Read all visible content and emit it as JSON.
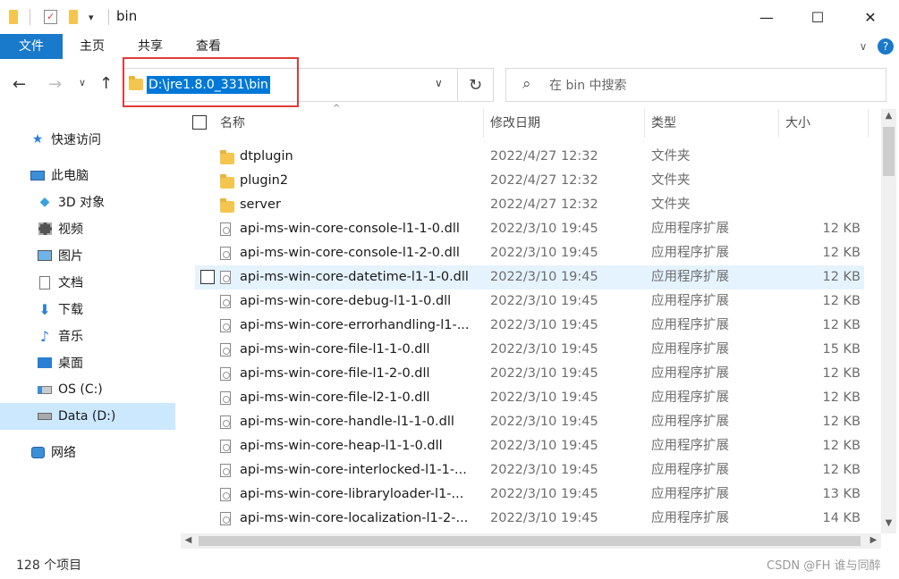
{
  "window": {
    "title": "bin",
    "minimize_glyph": "—",
    "maximize_glyph": "☐",
    "close_glyph": "✕"
  },
  "ribbon": {
    "tabs": [
      "文件",
      "主页",
      "共享",
      "查看"
    ],
    "collapse_glyph": "∨",
    "help_glyph": "?"
  },
  "address": {
    "path": "D:\\jre1.8.0_331\\bin",
    "dropdown_glyph": "∨",
    "refresh_glyph": "↻",
    "search_placeholder": "在 bin 中搜索"
  },
  "sidebar": {
    "items": [
      {
        "label": "快速访问",
        "icon": "star-icon"
      },
      {
        "label": "此电脑",
        "icon": "computer-icon"
      },
      {
        "label": "3D 对象",
        "icon": "3d-objects-icon"
      },
      {
        "label": "视频",
        "icon": "video-icon"
      },
      {
        "label": "图片",
        "icon": "pictures-icon"
      },
      {
        "label": "文档",
        "icon": "documents-icon"
      },
      {
        "label": "下载",
        "icon": "download-icon"
      },
      {
        "label": "音乐",
        "icon": "music-icon"
      },
      {
        "label": "桌面",
        "icon": "desktop-icon"
      },
      {
        "label": "OS (C:)",
        "icon": "drive-c-icon"
      },
      {
        "label": "Data (D:)",
        "icon": "drive-d-icon",
        "selected": true
      },
      {
        "label": "网络",
        "icon": "network-icon"
      }
    ]
  },
  "columns": {
    "name": "名称",
    "date": "修改日期",
    "type": "类型",
    "size": "大小"
  },
  "files": [
    {
      "name": "dtplugin",
      "date": "2022/4/27 12:32",
      "type": "文件夹",
      "size": "",
      "kind": "folder"
    },
    {
      "name": "plugin2",
      "date": "2022/4/27 12:32",
      "type": "文件夹",
      "size": "",
      "kind": "folder"
    },
    {
      "name": "server",
      "date": "2022/4/27 12:32",
      "type": "文件夹",
      "size": "",
      "kind": "folder"
    },
    {
      "name": "api-ms-win-core-console-l1-1-0.dll",
      "date": "2022/3/10 19:45",
      "type": "应用程序扩展",
      "size": "12 KB",
      "kind": "dll"
    },
    {
      "name": "api-ms-win-core-console-l1-2-0.dll",
      "date": "2022/3/10 19:45",
      "type": "应用程序扩展",
      "size": "12 KB",
      "kind": "dll"
    },
    {
      "name": "api-ms-win-core-datetime-l1-1-0.dll",
      "date": "2022/3/10 19:45",
      "type": "应用程序扩展",
      "size": "12 KB",
      "kind": "dll",
      "hover": true
    },
    {
      "name": "api-ms-win-core-debug-l1-1-0.dll",
      "date": "2022/3/10 19:45",
      "type": "应用程序扩展",
      "size": "12 KB",
      "kind": "dll"
    },
    {
      "name": "api-ms-win-core-errorhandling-l1-...",
      "date": "2022/3/10 19:45",
      "type": "应用程序扩展",
      "size": "12 KB",
      "kind": "dll"
    },
    {
      "name": "api-ms-win-core-file-l1-1-0.dll",
      "date": "2022/3/10 19:45",
      "type": "应用程序扩展",
      "size": "15 KB",
      "kind": "dll"
    },
    {
      "name": "api-ms-win-core-file-l1-2-0.dll",
      "date": "2022/3/10 19:45",
      "type": "应用程序扩展",
      "size": "12 KB",
      "kind": "dll"
    },
    {
      "name": "api-ms-win-core-file-l2-1-0.dll",
      "date": "2022/3/10 19:45",
      "type": "应用程序扩展",
      "size": "12 KB",
      "kind": "dll"
    },
    {
      "name": "api-ms-win-core-handle-l1-1-0.dll",
      "date": "2022/3/10 19:45",
      "type": "应用程序扩展",
      "size": "12 KB",
      "kind": "dll"
    },
    {
      "name": "api-ms-win-core-heap-l1-1-0.dll",
      "date": "2022/3/10 19:45",
      "type": "应用程序扩展",
      "size": "12 KB",
      "kind": "dll"
    },
    {
      "name": "api-ms-win-core-interlocked-l1-1-...",
      "date": "2022/3/10 19:45",
      "type": "应用程序扩展",
      "size": "12 KB",
      "kind": "dll"
    },
    {
      "name": "api-ms-win-core-libraryloader-l1-...",
      "date": "2022/3/10 19:45",
      "type": "应用程序扩展",
      "size": "13 KB",
      "kind": "dll"
    },
    {
      "name": "api-ms-win-core-localization-l1-2-...",
      "date": "2022/3/10 19:45",
      "type": "应用程序扩展",
      "size": "14 KB",
      "kind": "dll"
    }
  ],
  "status": {
    "item_count": "128 个项目"
  },
  "watermark": "CSDN @FH 谁与同醉",
  "colors": {
    "file_tab": "#1979ca",
    "selection": "#0078d7",
    "highlight_box": "#e03b3b",
    "nav_selected": "#cce8ff",
    "row_hover": "#e5f3ff"
  }
}
